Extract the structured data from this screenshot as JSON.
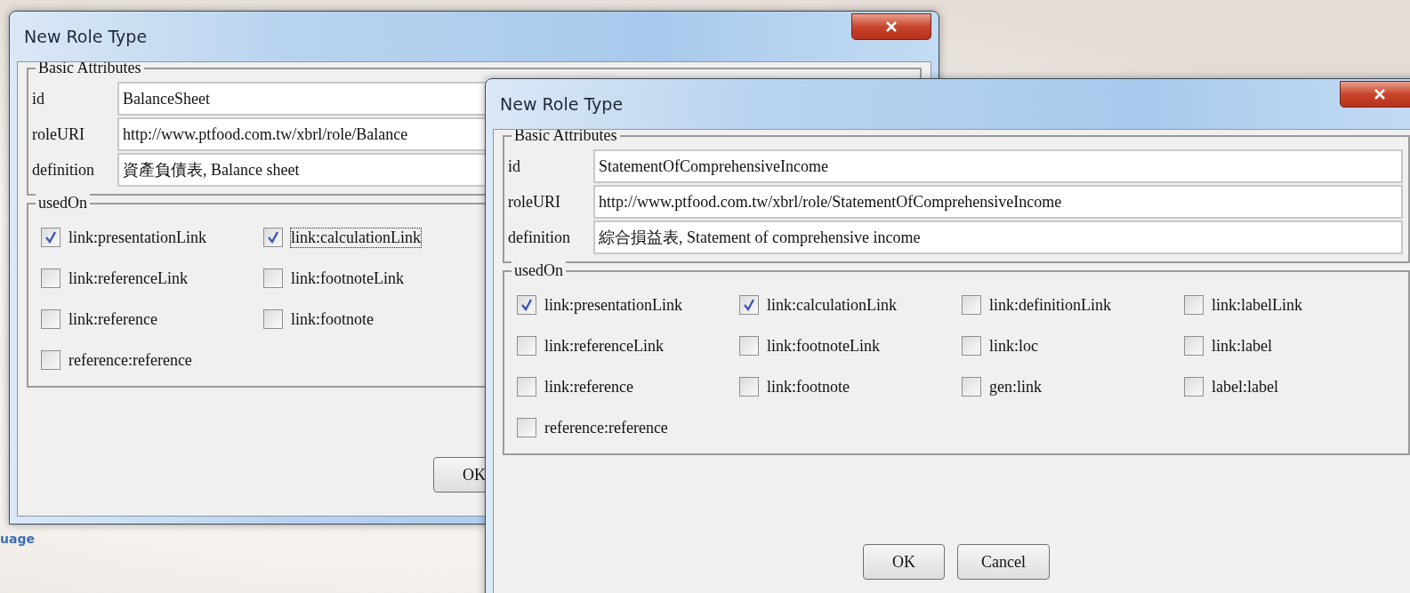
{
  "desktop": {
    "text": "uage"
  },
  "dialogs": [
    {
      "title": "New Role Type",
      "basic_attributes": {
        "legend": "Basic Attributes",
        "fields": [
          {
            "label": "id",
            "value": "BalanceSheet"
          },
          {
            "label": "roleURI",
            "value": "http://www.ptfood.com.tw/xbrl/role/Balance"
          },
          {
            "label": "definition",
            "value": "資產負債表, Balance sheet"
          }
        ]
      },
      "used_on": {
        "legend": "usedOn",
        "rows": [
          [
            {
              "label": "link:presentationLink",
              "checked": true,
              "focused": false
            },
            {
              "label": "link:calculationLink",
              "checked": true,
              "focused": true
            }
          ],
          [
            {
              "label": "link:referenceLink",
              "checked": false,
              "focused": false
            },
            {
              "label": "link:footnoteLink",
              "checked": false,
              "focused": false
            }
          ],
          [
            {
              "label": "link:reference",
              "checked": false,
              "focused": false
            },
            {
              "label": "link:footnote",
              "checked": false,
              "focused": false
            }
          ],
          [
            {
              "label": "reference:reference",
              "checked": false,
              "focused": false
            }
          ]
        ]
      },
      "buttons": [
        "OK"
      ]
    },
    {
      "title": "New Role Type",
      "basic_attributes": {
        "legend": "Basic Attributes",
        "fields": [
          {
            "label": "id",
            "value": "StatementOfComprehensiveIncome"
          },
          {
            "label": "roleURI",
            "value": "http://www.ptfood.com.tw/xbrl/role/StatementOfComprehensiveIncome"
          },
          {
            "label": "definition",
            "value": "綜合損益表, Statement of comprehensive income"
          }
        ]
      },
      "used_on": {
        "legend": "usedOn",
        "rows": [
          [
            {
              "label": "link:presentationLink",
              "checked": true,
              "focused": false
            },
            {
              "label": "link:calculationLink",
              "checked": true,
              "focused": false
            },
            {
              "label": "link:definitionLink",
              "checked": false,
              "focused": false
            },
            {
              "label": "link:labelLink",
              "checked": false,
              "focused": false
            }
          ],
          [
            {
              "label": "link:referenceLink",
              "checked": false,
              "focused": false
            },
            {
              "label": "link:footnoteLink",
              "checked": false,
              "focused": false
            },
            {
              "label": "link:loc",
              "checked": false,
              "focused": false
            },
            {
              "label": "link:label",
              "checked": false,
              "focused": false
            }
          ],
          [
            {
              "label": "link:reference",
              "checked": false,
              "focused": false
            },
            {
              "label": "link:footnote",
              "checked": false,
              "focused": false
            },
            {
              "label": "gen:link",
              "checked": false,
              "focused": false
            },
            {
              "label": "label:label",
              "checked": false,
              "focused": false
            }
          ],
          [
            {
              "label": "reference:reference",
              "checked": false,
              "focused": false
            }
          ]
        ]
      },
      "buttons": [
        "OK",
        "Cancel"
      ]
    }
  ]
}
